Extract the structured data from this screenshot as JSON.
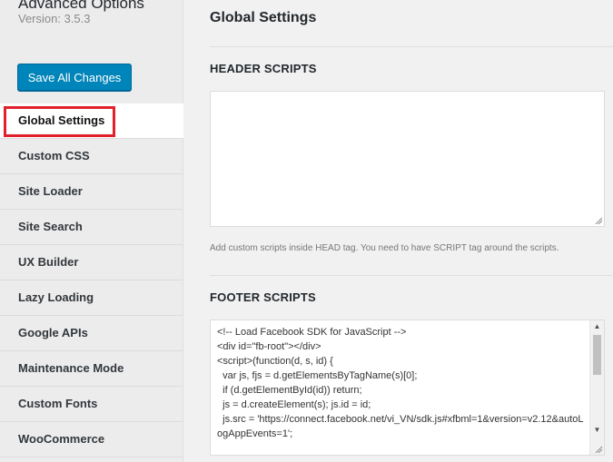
{
  "sidebar": {
    "app_title": "Advanced Options",
    "version": "Version: 3.5.3",
    "save_button": "Save All Changes",
    "items": [
      {
        "label": "Global Settings",
        "active": true
      },
      {
        "label": "Custom CSS"
      },
      {
        "label": "Site Loader"
      },
      {
        "label": "Site Search"
      },
      {
        "label": "UX Builder"
      },
      {
        "label": "Lazy Loading"
      },
      {
        "label": "Google APIs"
      },
      {
        "label": "Maintenance Mode"
      },
      {
        "label": "Custom Fonts"
      },
      {
        "label": "WooCommerce"
      }
    ]
  },
  "main": {
    "page_title": "Global Settings",
    "header_scripts": {
      "title": "HEADER SCRIPTS",
      "value": "",
      "hint": "Add custom scripts inside HEAD tag. You need to have SCRIPT tag around the scripts."
    },
    "footer_scripts": {
      "title": "FOOTER SCRIPTS",
      "value": "<!-- Load Facebook SDK for JavaScript -->\n<div id=\"fb-root\"></div>\n<script>(function(d, s, id) {\n  var js, fjs = d.getElementsByTagName(s)[0];\n  if (d.getElementById(id)) return;\n  js = d.createElement(s); js.id = id;\n  js.src = 'https://connect.facebook.net/vi_VN/sdk.js#xfbml=1&version=v2.12&autoLogAppEvents=1';"
    }
  },
  "colors": {
    "accent": "#0085ba",
    "highlight": "#e0202b"
  }
}
